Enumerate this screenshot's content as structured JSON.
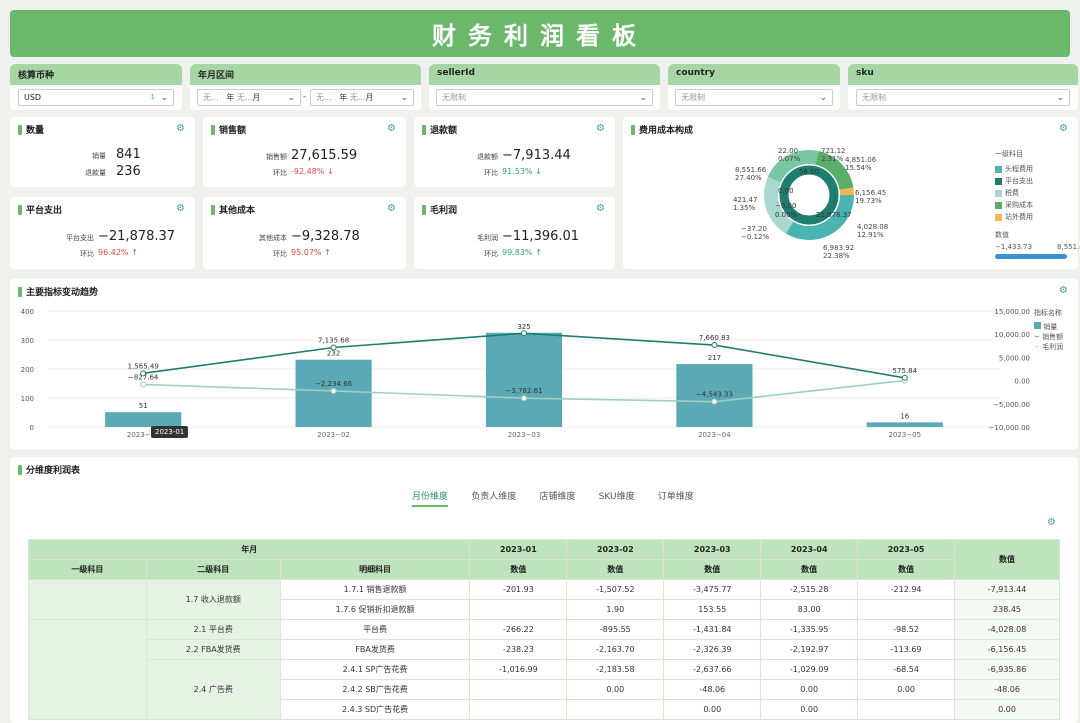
{
  "header": {
    "title": "财务利润看板"
  },
  "filters": {
    "currency": {
      "label": "核算币种",
      "value": "USD",
      "count": "1"
    },
    "period": {
      "label": "年月区间",
      "none": "无...",
      "year": "年",
      "month": "月",
      "sep": "-"
    },
    "sellerId": {
      "label": "sellerId",
      "placeholder": "无限制"
    },
    "country": {
      "label": "country",
      "placeholder": "无限制"
    },
    "sku": {
      "label": "sku",
      "placeholder": "无限制"
    }
  },
  "kpis": {
    "quantity": {
      "title": "数量",
      "l1": "销量",
      "v1": "841",
      "l2": "退款量",
      "v2": "236"
    },
    "sales": {
      "title": "销售额",
      "l1": "销售额",
      "v1": "27,615.59",
      "cmp": "环比",
      "pct": "-92.48%",
      "arrow": "↓"
    },
    "refund": {
      "title": "退款额",
      "l1": "退款额",
      "v1": "−7,913.44",
      "cmp": "环比",
      "pct": "91.53%",
      "arrow": "↓"
    },
    "platform": {
      "title": "平台支出",
      "l1": "平台支出",
      "v1": "−21,878.37",
      "cmp": "环比",
      "pct": "96.42%",
      "arrow": "↑"
    },
    "other": {
      "title": "其他成本",
      "l1": "其他成本",
      "v1": "−9,328.78",
      "cmp": "环比",
      "pct": "95.07%",
      "arrow": "↑"
    },
    "gross": {
      "title": "毛利润",
      "l1": "毛利润",
      "v1": "−11,396.01",
      "cmp": "环比",
      "pct": "99.83%",
      "arrow": "↑"
    }
  },
  "donut": {
    "title": "费用成本构成",
    "legend_title": "一级科目",
    "legend": [
      {
        "name": "头程费用",
        "color": "#4bb3b0"
      },
      {
        "name": "平台支出",
        "color": "#1f7d70"
      },
      {
        "name": "税费",
        "color": "#a9d8cf"
      },
      {
        "name": "采购成本",
        "color": "#5aae6a"
      },
      {
        "name": "站外费用",
        "color": "#f3b453"
      }
    ],
    "range_title": "数值",
    "range_min": "−1,433.73",
    "range_max": "8,551.66",
    "labels": [
      {
        "t1": "22.00",
        "t2": "0.07%"
      },
      {
        "t1": "721.12",
        "t2": "2.31%"
      },
      {
        "t1": "4,851.06",
        "t2": "15.54%"
      },
      {
        "t1": "8,551.66",
        "t2": "27.40%"
      },
      {
        "t1": "6,156.45",
        "t2": "19.73%"
      },
      {
        "t1": "421.47",
        "t2": "1.35%"
      },
      {
        "t1": "4,028.08",
        "t2": "12.91%"
      },
      {
        "t1": "−37.20",
        "t2": "−0.12%"
      },
      {
        "t1": "6,983.92",
        "t2": "22.38%"
      }
    ],
    "inner": [
      "56.00",
      "0.00",
      "−0.00",
      "0.00%",
      "21,878.37"
    ]
  },
  "trend": {
    "title": "主要指标变动趋势",
    "legend_title": "指标名称",
    "legend": [
      "销量",
      "销售额",
      "毛利润"
    ],
    "tooltip": "2023-01"
  },
  "chart_data": {
    "type": "bar",
    "categories": [
      "2023−01",
      "2023−02",
      "2023−03",
      "2023−04",
      "2023−05"
    ],
    "series": [
      {
        "name": "销量",
        "values": [
          51,
          232,
          325,
          217,
          16
        ],
        "labels": [
          "51",
          "232",
          "325",
          "217",
          "16"
        ]
      },
      {
        "name": "销售额",
        "values": [
          1565.49,
          7135.68,
          10200,
          7660.83,
          575.84
        ],
        "labels": [
          "1,565.49",
          "7,135.68",
          "",
          "7,660.83",
          "575.84"
        ]
      },
      {
        "name": "毛利润",
        "values": [
          -827.64,
          -2234.66,
          -3782.61,
          -4543.33,
          0
        ],
        "labels": [
          "−827.64",
          "−2,234.66",
          "−3,782.61",
          "−4,543.33",
          ""
        ]
      }
    ],
    "yticks_left": [
      "400",
      "300",
      "200",
      "100",
      "0"
    ],
    "yticks_right": [
      "15,000.00",
      "10,000.00",
      "5,000.00",
      "0.00",
      "−5,000.00",
      "−10,000.00"
    ],
    "ylim_left": [
      0,
      400
    ],
    "ylim_right": [
      -10000,
      15000
    ]
  },
  "table": {
    "title": "分维度利润表",
    "tabs": [
      "月份维度",
      "负责人维度",
      "店铺维度",
      "SKU维度",
      "订单维度"
    ],
    "hdr_year": "年月",
    "hdr_cols": [
      "一级科目",
      "二级科目",
      "明细科目"
    ],
    "months": [
      "2023-01",
      "2023-02",
      "2023-03",
      "2023-04",
      "2023-05"
    ],
    "value": "数值",
    "rows": [
      {
        "l2": "1.7 收入退款额",
        "detail": "1.7.1 销售退款额",
        "v": [
          "-201.93",
          "-1,507.52",
          "-3,475.77",
          "-2,515.28",
          "-212.94",
          "-7,913.44"
        ]
      },
      {
        "l2": "",
        "detail": "1.7.6 促销折扣退款额",
        "v": [
          "",
          "1.90",
          "153.55",
          "83.00",
          "",
          "238.45"
        ]
      },
      {
        "l2": "2.1 平台费",
        "detail": "平台费",
        "v": [
          "-266.22",
          "-895.55",
          "-1,431.84",
          "-1,335.95",
          "-98.52",
          "-4,028.08"
        ]
      },
      {
        "l2": "2.2 FBA发货费",
        "detail": "FBA发货费",
        "v": [
          "-238.23",
          "-2,163.70",
          "-2,326.39",
          "-2,192.97",
          "-113.69",
          "-6,156.45"
        ]
      },
      {
        "l2": "2.4 广告费",
        "detail": "2.4.1 SP广告花费",
        "v": [
          "-1,016.99",
          "-2,183.58",
          "-2,637.66",
          "-1,029.09",
          "-68.54",
          "-6,935.86"
        ]
      },
      {
        "l2": "",
        "detail": "2.4.2 SB广告花费",
        "v": [
          "",
          "0.00",
          "-48.06",
          "0.00",
          "0.00",
          "-48.06"
        ]
      },
      {
        "l2": "",
        "detail": "2.4.3 SD广告花费",
        "v": [
          "",
          "",
          "0.00",
          "0.00",
          "",
          "0.00"
        ]
      }
    ]
  }
}
